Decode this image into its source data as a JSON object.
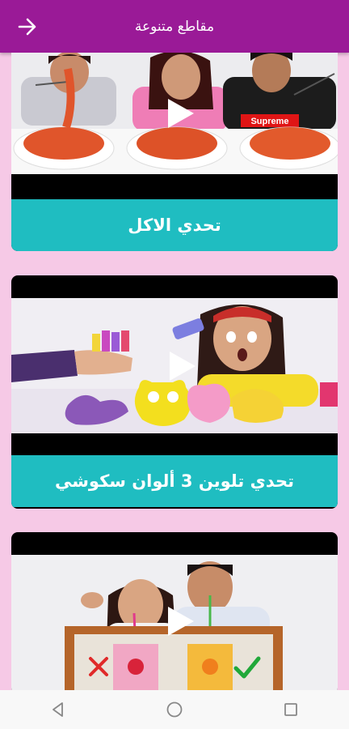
{
  "header": {
    "title": "مقاطع متنوعة",
    "back_icon": "arrow-right-icon"
  },
  "videos": [
    {
      "title": "تحدي الاكل",
      "shirt_text": "Supreme"
    },
    {
      "title": "تحدي تلوين 3 ألوان سكوشي"
    },
    {
      "title": ""
    }
  ],
  "colors": {
    "app_bar": "#9a1a97",
    "background": "#f6c9e6",
    "caption_bar": "#1fbdc1"
  },
  "nav": {
    "icons": [
      "back-triangle-icon",
      "home-circle-icon",
      "recents-square-icon"
    ]
  }
}
